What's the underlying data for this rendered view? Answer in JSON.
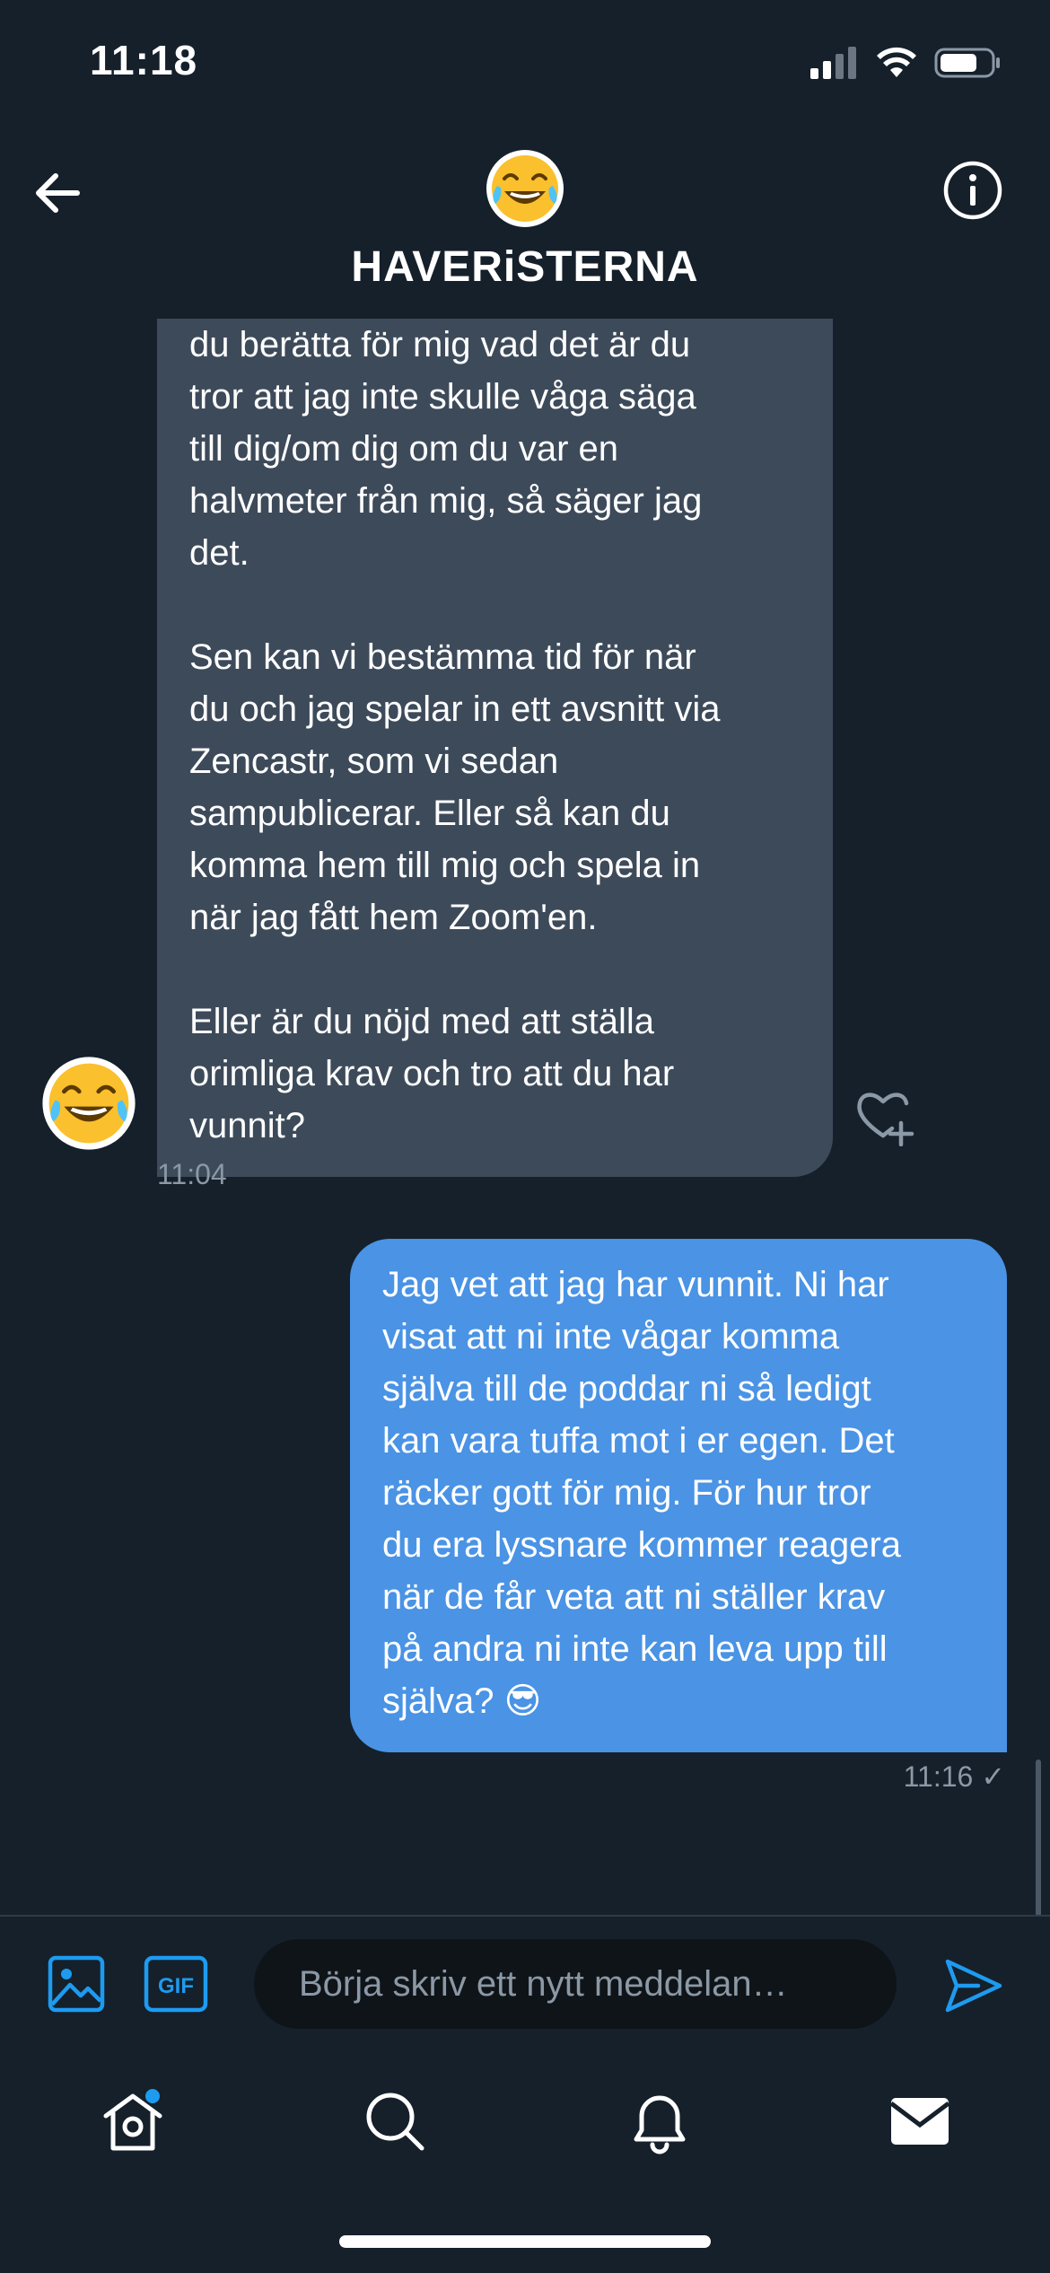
{
  "status_bar": {
    "time": "11:18"
  },
  "header": {
    "title": "HAVERiSTERNA",
    "avatar_emoji": "😂"
  },
  "thread": {
    "incoming": {
      "text": "du berätta för mig vad det är du\ntror att jag inte skulle våga säga\ntill dig/om dig om du var en\nhalvmeter från mig, så säger jag\ndet.\n\nSen kan vi bestämma tid för när\ndu och jag spelar in ett avsnitt via\nZencastr, som vi sedan\nsampublicerar. Eller så kan du\nkomma hem till mig och spela in\nnär jag fått hem Zoom'en.\n\nEller är du nöjd med att ställa\norimliga krav och tro att du har\nvunnit?",
      "time": "11:04",
      "avatar_emoji": "😂"
    },
    "outgoing": {
      "text": "Jag vet att jag har vunnit. Ni har\nvisat att ni inte vågar komma\nsjälva till de poddar ni så ledigt\nkan vara tuffa mot i er egen. Det\nräcker gott för mig. För hur tror\ndu era lyssnare kommer reagera\nnär de får veta att ni ställer krav\npå andra ni inte kan leva upp till\nsjälva? 😎",
      "time": "11:16 ✓"
    }
  },
  "composer": {
    "placeholder": "Börja skriv ett nytt meddelan…",
    "gif_label": "GIF"
  },
  "colors": {
    "background": "#15202b",
    "incoming_bubble": "#3d4a5a",
    "outgoing_bubble": "#4a93e5",
    "accent": "#1d9bf0"
  },
  "icons": {
    "back": "arrow-left-icon",
    "info": "info-icon",
    "media": "image-icon",
    "gif": "gif-icon",
    "send": "send-icon",
    "like": "heart-plus-icon",
    "home": "home-icon",
    "search": "search-icon",
    "notifications": "bell-icon",
    "messages": "envelope-icon"
  }
}
